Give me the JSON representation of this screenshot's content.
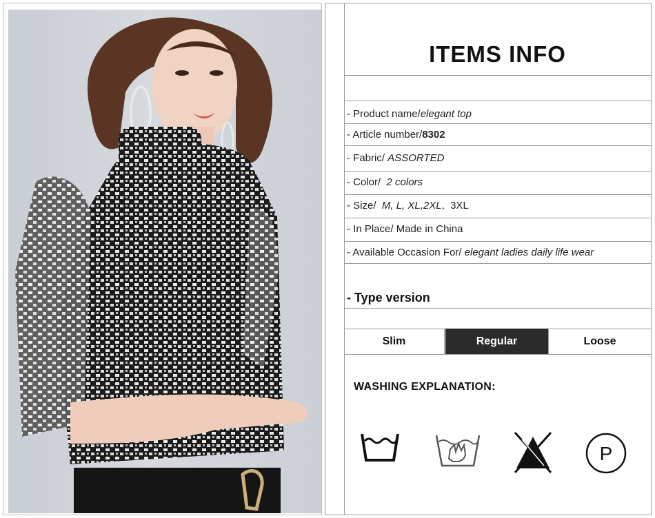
{
  "title": "ITEMS INFO",
  "rows": [
    {
      "label": "- Product name/",
      "value": "elegant top"
    },
    {
      "label": "- Article number/",
      "value": "8302"
    },
    {
      "label": "- Fabric/",
      "value": "ASSORTED"
    },
    {
      "label": "- Color/",
      "value": "2 colors"
    },
    {
      "label": "- Size/",
      "value": "M, L, XL,2XL",
      "value2": "3XL"
    },
    {
      "label": "- In Place/",
      "value": "Made in China"
    },
    {
      "label": "- Available Occasion For/",
      "value": "elegant ladies daily life wear"
    }
  ],
  "type_title": "- Type version",
  "type_options": [
    "Slim",
    "Regular",
    "Loose"
  ],
  "type_selected": "Regular",
  "wash_title": "WASHING EXPLANATION:",
  "wash_icons": [
    "machine-wash-icon",
    "hand-wash-icon",
    "do-not-bleach-icon",
    "dry-clean-p-icon"
  ],
  "wash_p_letter": "P",
  "photo_icon": "model-photo",
  "colors": {
    "selected_bg": "#2b2b2b",
    "line": "#9a9a9a"
  }
}
